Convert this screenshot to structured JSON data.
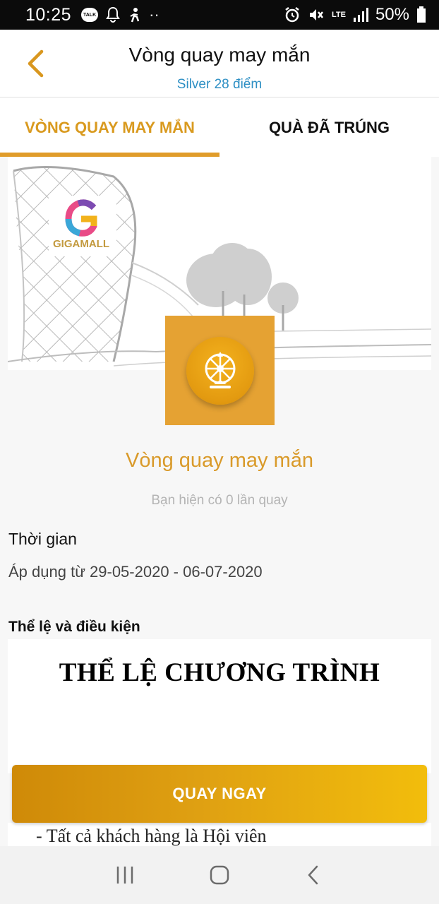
{
  "status_bar": {
    "time": "10:25",
    "talk_badge": "TALK",
    "dots": "··",
    "network": "LTE",
    "battery": "50%"
  },
  "header": {
    "title": "Vòng quay may mắn",
    "subtitle": "Silver 28 điểm"
  },
  "tabs": [
    {
      "label": "VÒNG QUAY MAY MẮN",
      "active": true
    },
    {
      "label": "QUÀ ĐÃ TRÚNG",
      "active": false
    }
  ],
  "banner": {
    "brand_text": "GIGAMALL"
  },
  "game": {
    "title": "Vòng quay may mắn",
    "spins_text": "Bạn hiện có 0 lần quay"
  },
  "time_section": {
    "label": "Thời gian",
    "value": "Áp dụng từ 29-05-2020 - 06-07-2020"
  },
  "rules_section": {
    "label": "Thể lệ và điều kiện",
    "heading": "THỂ LỆ CHƯƠNG TRÌNH",
    "first_line": "-      Tất cả khách hàng là Hội viên"
  },
  "action": {
    "spin_button": "QUAY NGAY"
  },
  "colors": {
    "accent": "#e09c2a",
    "link": "#2d8fc4",
    "button_start": "#cf8a08",
    "button_end": "#f2bd0c"
  }
}
